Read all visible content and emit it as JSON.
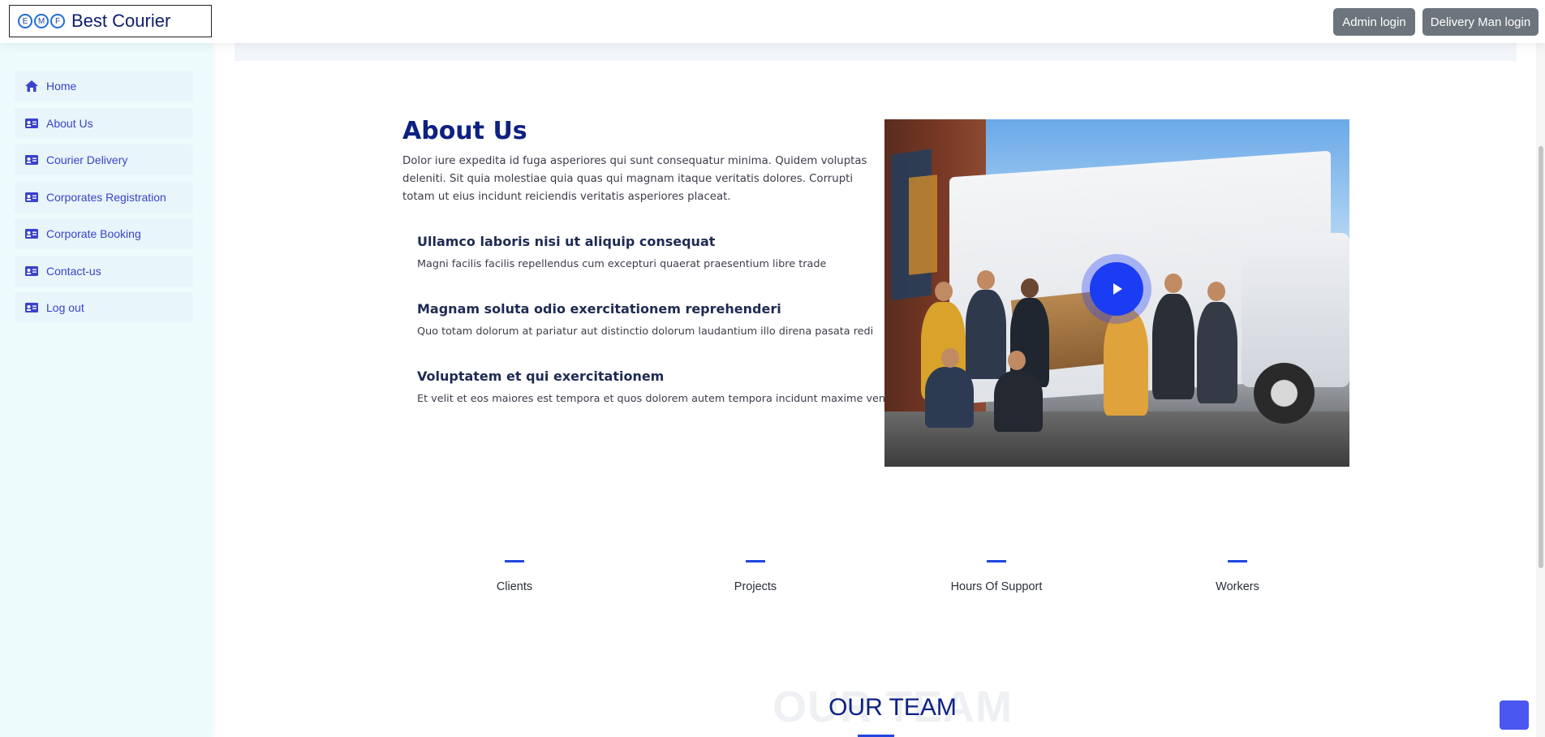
{
  "header": {
    "brand_letters": [
      "E",
      "M",
      "F"
    ],
    "brand_name": "Best Courier",
    "admin_login": "Admin login",
    "delivery_login": "Delivery Man login"
  },
  "sidebar": {
    "items": [
      {
        "label": "Home",
        "icon": "home-icon"
      },
      {
        "label": "About Us",
        "icon": "id-card-icon"
      },
      {
        "label": "Courier Delivery",
        "icon": "id-card-icon"
      },
      {
        "label": "Corporates Registration",
        "icon": "id-card-icon"
      },
      {
        "label": "Corporate Booking",
        "icon": "id-card-icon"
      },
      {
        "label": "Contact-us",
        "icon": "id-card-icon"
      },
      {
        "label": "Log out",
        "icon": "id-card-icon"
      }
    ]
  },
  "about": {
    "title": "About Us",
    "description": "Dolor iure expedita id fuga asperiores qui sunt consequatur minima. Quidem voluptas deleniti. Sit quia molestiae quia quas qui magnam itaque veritatis dolores. Corrupti totam ut eius incidunt reiciendis veritatis asperiores placeat.",
    "features": [
      {
        "title": "Ullamco laboris nisi ut aliquip consequat",
        "text": "Magni facilis facilis repellendus cum excepturi quaerat praesentium libre trade"
      },
      {
        "title": "Magnam soluta odio exercitationem reprehenderi",
        "text": "Quo totam dolorum at pariatur aut distinctio dolorum laudantium illo direna pasata redi"
      },
      {
        "title": "Voluptatem et qui exercitationem",
        "text": "Et velit et eos maiores est tempora et quos dolorem autem tempora incidunt maxime veniam"
      }
    ]
  },
  "stats": [
    {
      "label": "Clients"
    },
    {
      "label": "Projects"
    },
    {
      "label": "Hours Of Support"
    },
    {
      "label": "Workers"
    }
  ],
  "team": {
    "background_text": "OUR TEAM",
    "title": "OUR TEAM"
  },
  "colors": {
    "brand_navy": "#0d2182",
    "accent_blue": "#1f47e0",
    "sidebar_bg": "#ecfcfd",
    "sidebar_link": "#3a43c9",
    "header_button": "#6c757d"
  }
}
